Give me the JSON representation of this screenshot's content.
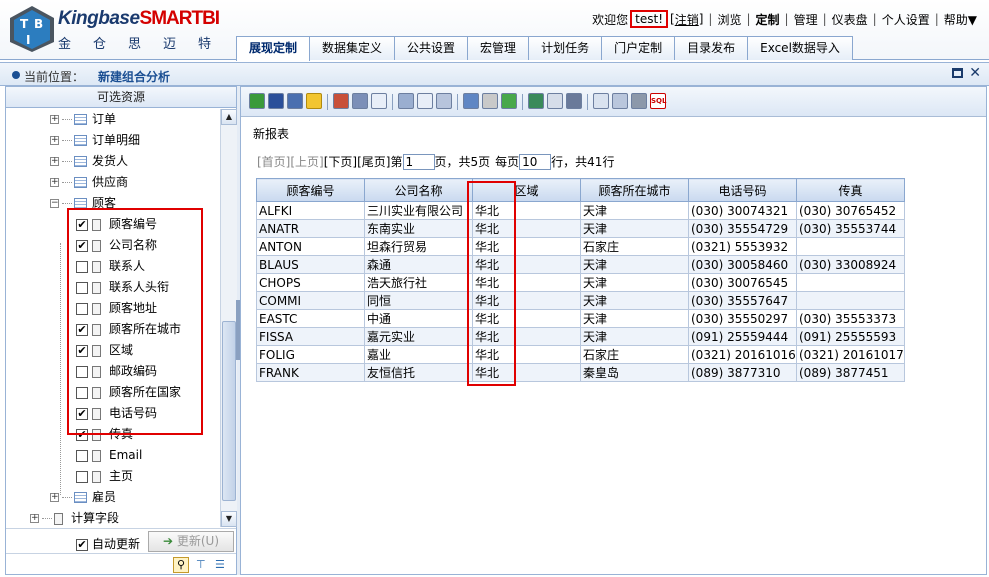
{
  "header": {
    "logo_brand": "Kingbase",
    "logo_brand_red": "SMARTBI",
    "logo_sub": "金仓思迈特",
    "welcome": "欢迎您",
    "user": "test!",
    "logout": "注销",
    "nav": [
      "浏览",
      "定制",
      "管理",
      "仪表盘",
      "个人设置",
      "帮助▼"
    ],
    "active_nav": "定制"
  },
  "tabs": [
    "展现定制",
    "数据集定义",
    "公共设置",
    "宏管理",
    "计划任务",
    "门户定制",
    "目录发布",
    "Excel数据导入"
  ],
  "location": {
    "label": "当前位置：",
    "value": "新建组合分析"
  },
  "left_panel": {
    "title": "可选资源",
    "tree": {
      "tables_top": [
        "订单",
        "订单明细",
        "发货人",
        "供应商"
      ],
      "customer": "顾客",
      "fields": [
        {
          "label": "顾客编号",
          "checked": true
        },
        {
          "label": "公司名称",
          "checked": true
        },
        {
          "label": "联系人",
          "checked": false
        },
        {
          "label": "联系人头衔",
          "checked": false
        },
        {
          "label": "顾客地址",
          "checked": false
        },
        {
          "label": "顾客所在城市",
          "checked": true
        },
        {
          "label": "区域",
          "checked": true
        },
        {
          "label": "邮政编码",
          "checked": false
        },
        {
          "label": "顾客所在国家",
          "checked": false
        },
        {
          "label": "电话号码",
          "checked": true
        },
        {
          "label": "传真",
          "checked": true
        },
        {
          "label": "Email",
          "checked": false
        },
        {
          "label": "主页",
          "checked": false
        }
      ],
      "employee": "雇员",
      "calc_fields": "计算字段"
    },
    "auto_update": "自动更新",
    "refresh": "更新(U)"
  },
  "report": {
    "title": "新报表",
    "pager": {
      "first": "[首页]",
      "prev": "[上页]",
      "next": "[下页]",
      "last": "[尾页]",
      "page_prefix": "第",
      "page_value": "1",
      "page_suffix": "页，共5页",
      "per_prefix": "每页",
      "per_value": "10",
      "per_suffix": "行，共41行"
    },
    "columns": [
      "顾客编号",
      "公司名称",
      "区域",
      "顾客所在城市",
      "电话号码",
      "传真"
    ],
    "rows": [
      [
        "ALFKI",
        "三川实业有限公司",
        "华北",
        "天津",
        "(030) 30074321",
        "(030) 30765452"
      ],
      [
        "ANATR",
        "东南实业",
        "华北",
        "天津",
        "(030) 35554729",
        "(030) 35553744"
      ],
      [
        "ANTON",
        "坦森行贸易",
        "华北",
        "石家庄",
        "(0321) 5553932",
        ""
      ],
      [
        "BLAUS",
        "森通",
        "华北",
        "天津",
        "(030) 30058460",
        "(030)  33008924"
      ],
      [
        "CHOPS",
        "浩天旅行社",
        "华北",
        "天津",
        "(030) 30076545",
        ""
      ],
      [
        "COMMI",
        "同恒",
        "华北",
        "天津",
        "(030) 35557647",
        ""
      ],
      [
        "EASTC",
        "中通",
        "华北",
        "天津",
        "(030) 35550297",
        "(030) 35553373"
      ],
      [
        "FISSA",
        "嘉元实业",
        "华北",
        "天津",
        "(091) 25559444",
        "(091) 25555593"
      ],
      [
        "FOLIG",
        "嘉业",
        "华北",
        "石家庄",
        "(0321) 20161016",
        "(0321) 20161017"
      ],
      [
        "FRANK",
        "友恒信托",
        "华北",
        "秦皇岛",
        "(089) 3877310",
        "(089) 3877451"
      ]
    ]
  },
  "icons": {
    "toolbar": [
      "refresh-icon",
      "save-icon",
      "save-as-icon",
      "favorite-icon",
      "chart-icon",
      "copy-icon",
      "layout-icon",
      "filter-icon",
      "sum-icon",
      "settings-icon",
      "export-icon",
      "print-icon",
      "refresh-data-icon",
      "excel-icon",
      "sort-icon",
      "param-icon",
      "view-icon",
      "help-icon",
      "query-icon",
      "sql-icon"
    ]
  }
}
